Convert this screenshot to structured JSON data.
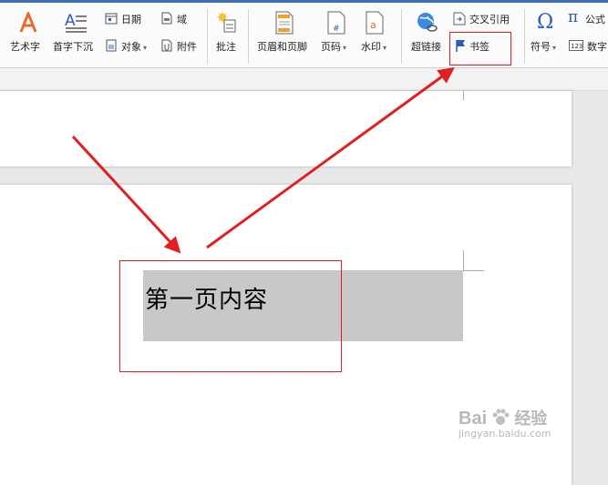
{
  "toolbar": {
    "wordart_label": "艺术字",
    "dropcap_label": "首字下沉",
    "date_label": "日期",
    "object_label": "对象",
    "field_label": "域",
    "attachment_label": "附件",
    "comment_label": "批注",
    "header_footer_label": "页眉和页脚",
    "page_number_label": "页码",
    "watermark_label": "水印",
    "hyperlink_label": "超链接",
    "cross_ref_label": "交叉引用",
    "bookmark_label": "书签",
    "symbol_label": "符号",
    "formula_label": "公式",
    "number_label": "数字"
  },
  "document": {
    "content_text": "第一页内容"
  },
  "watermark": {
    "brand": "Bai",
    "brand2": "经验",
    "url": "jingyan.baidu.com"
  },
  "colors": {
    "accent": "#3c6db5",
    "annotation_red": "#e02020",
    "highlight": "#c8c8c8"
  }
}
